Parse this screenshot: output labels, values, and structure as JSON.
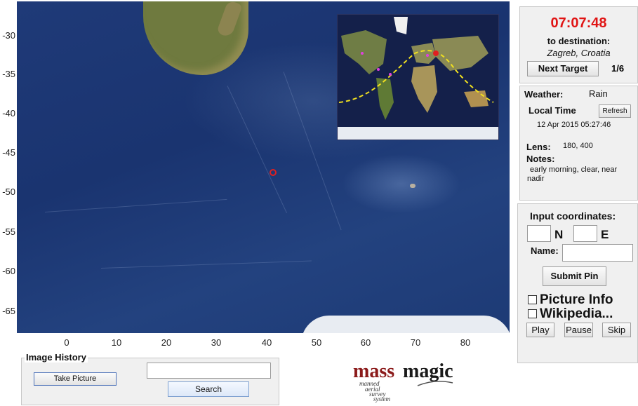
{
  "map": {
    "y_ticks": [
      "-30",
      "-35",
      "-40",
      "-45",
      "-50",
      "-55",
      "-60",
      "-65"
    ],
    "x_ticks": [
      "0",
      "10",
      "20",
      "30",
      "40",
      "50",
      "60",
      "70",
      "80"
    ]
  },
  "destination": {
    "timer": "07:07:48",
    "label": "to destination:",
    "city": "Zagreb, Croatia",
    "next_button": "Next Target",
    "counter": "1/6"
  },
  "info": {
    "weather_label": "Weather:",
    "weather_value": "Rain",
    "local_time_label": "Local Time",
    "refresh_button": "Refresh",
    "local_time_value": "12 Apr 2015 05:27:46",
    "lens_label": "Lens:",
    "lens_value": "180, 400",
    "notes_label": "Notes:",
    "notes_line1": "early morning, clear, near",
    "notes_line2": "nadir"
  },
  "input": {
    "title": "Input coordinates:",
    "lat_value": "",
    "lat_unit": "N",
    "lon_value": "",
    "lon_unit": "E",
    "name_label": "Name:",
    "name_value": "",
    "submit_button": "Submit Pin",
    "picture_info": "Picture Info",
    "wikipedia": "Wikipedia...",
    "play": "Play",
    "pause": "Pause",
    "skip": "Skip"
  },
  "history": {
    "title": "Image History",
    "take_button": "Take Picture",
    "search_value": "",
    "search_button": "Search"
  },
  "logo": {
    "name": "massmagic",
    "tagline": "manned aerial survey system"
  }
}
